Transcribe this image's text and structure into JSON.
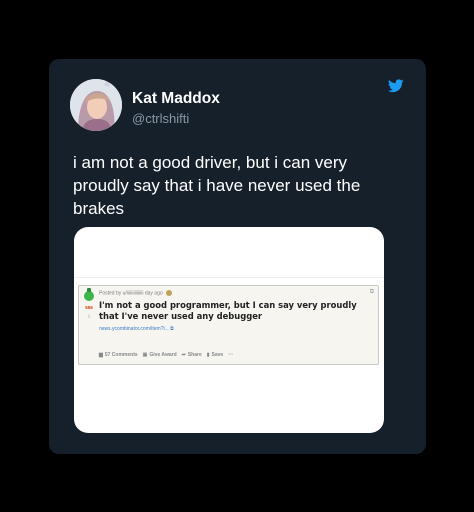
{
  "tweet": {
    "author_name": "Kat Maddox",
    "author_handle": "@ctrlshifti",
    "text": "i am not a good driver, but i can very proudly say that i have never used the brakes"
  },
  "embedded_post": {
    "score": "555",
    "meta_posted_by": "Posted by u/",
    "meta_user": "[illegible]",
    "meta_time": "day ago",
    "title": "I'm not a good programmer, but I can say very proudly that I've never used any debugger",
    "link": "news.ycombinator.com/item?i...",
    "actions": {
      "comments": "57 Comments",
      "award": "Give Award",
      "share": "Share",
      "save": "Save",
      "more": "···"
    }
  },
  "colors": {
    "card_bg": "#15202b",
    "twitter_blue": "#1d9bf0",
    "upvote_green": "#3cb54a",
    "score_red": "#d93a00"
  },
  "icons": [
    "avatar",
    "twitter-bird-icon",
    "upvote-icon",
    "downvote-icon",
    "external-link-icon",
    "comment-icon",
    "gift-icon",
    "share-icon",
    "save-icon"
  ]
}
